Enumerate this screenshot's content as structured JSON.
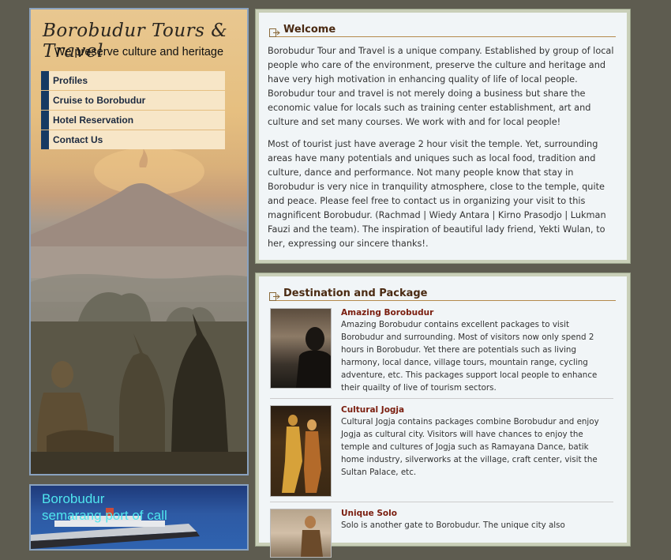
{
  "site": {
    "title": "Borobudur Tours & Travel",
    "tagline": "We preserve culture and heritage"
  },
  "nav": {
    "items": [
      {
        "label": "Profiles"
      },
      {
        "label": "Cruise to Borobudur"
      },
      {
        "label": "Hotel Reservation"
      },
      {
        "label": "Contact Us"
      }
    ]
  },
  "ship_banner": {
    "line1": "Borobudur",
    "line2": "semarang port of call"
  },
  "welcome": {
    "heading": "Welcome",
    "paragraph1": "Borobudur Tour and Travel is a unique company. Established by group of local people who care of the environment, preserve the culture and heritage and have very high motivation in enhancing quality of life of local people. Borobudur tour and travel is not merely doing a business but share the economic value for locals such as training center establishment, art and culture and set many courses. We work with and for local people!",
    "paragraph2": "Most of tourist just have average 2 hour visit the temple. Yet, surrounding areas have many potentials and uniques such as local food, tradition and culture, dance and performance. Not many people know that stay in Borobudur is very nice in tranquility atmosphere, close to the temple, quite and peace. Please feel free to contact us in organizing your visit to this magnificent Borobudur. (Rachmad | Wiedy Antara | Kirno Prasodjo | Lukman Fauzi and the team). The inspiration of beautiful lady friend, Yekti Wulan, to her, expressing our sincere thanks!."
  },
  "destination": {
    "heading": "Destination and Package",
    "packages": [
      {
        "title": "Amazing Borobudur",
        "desc": "Amazing Borobudur contains excellent packages to visit Borobudur and surrounding. Most of visitors now only spend 2 hours in Borobudur. Yet there are potentials such as living harmony, local dance, village tours, mountain range, cycling adventure, etc. This packages support local people to enhance their quailty of live of tourism sectors."
      },
      {
        "title": "Cultural Jogja",
        "desc": "Cultural Jogja contains packages combine Borobudur and enjoy Jogja as cultural city. Visitors will have chances to enjoy the temple and cultures of Jogja such as Ramayana Dance, batik home industry, silverworks at the village, craft center, visit the Sultan Palace, etc."
      },
      {
        "title": "Unique Solo",
        "desc": "Solo is another gate to Borobudur. The unique city also"
      }
    ]
  }
}
